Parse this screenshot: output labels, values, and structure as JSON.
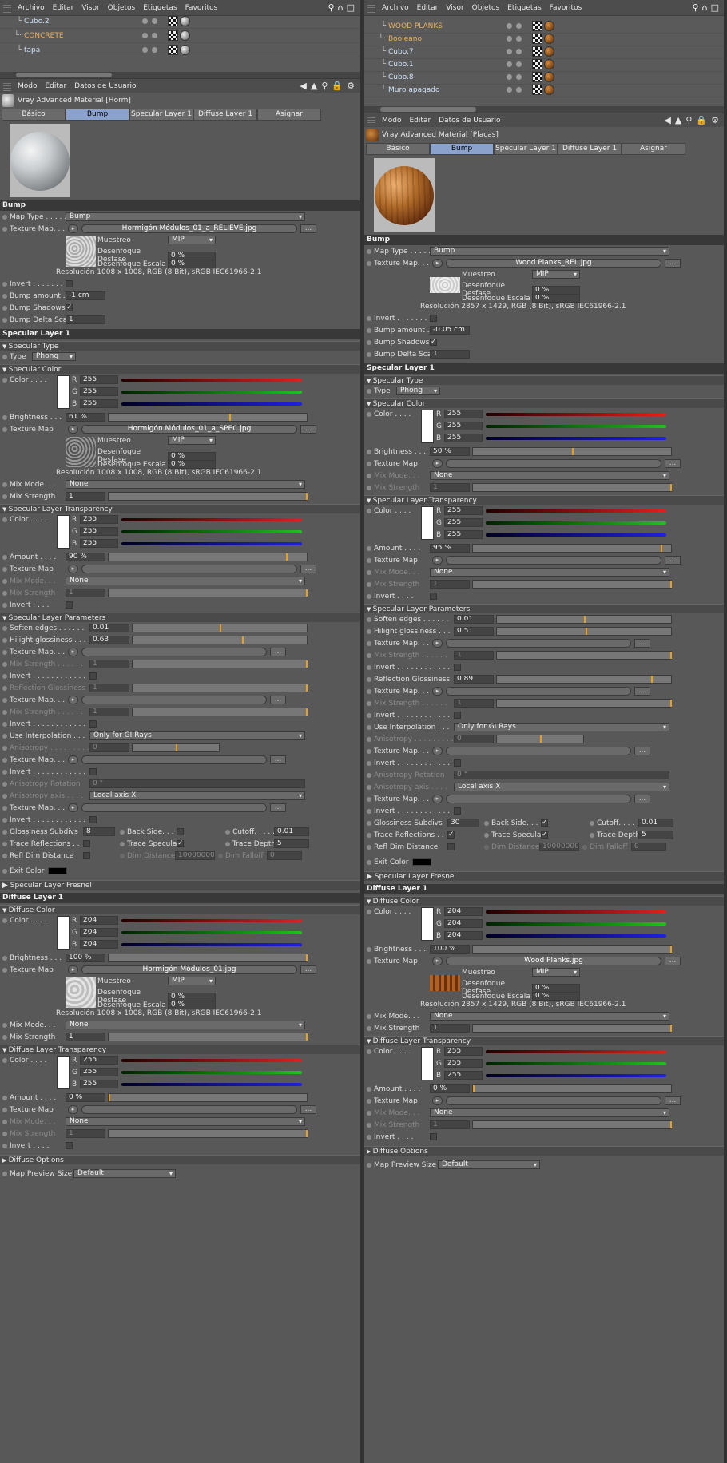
{
  "menu": {
    "items": [
      "Archivo",
      "Editar",
      "Visor",
      "Objetos",
      "Etiquetas",
      "Favoritos"
    ]
  },
  "attr_menu": {
    "items": [
      "Modo",
      "Editar",
      "Datos de Usuario"
    ]
  },
  "left": {
    "objects": [
      "Cubo.2",
      "CONCRETE",
      "tapa"
    ],
    "material_title": "Vray Advanced Material [Horm]",
    "tabs": [
      "Básico",
      "Bump",
      "Specular Layer 1",
      "Diffuse Layer 1",
      "Asignar"
    ],
    "bump": {
      "section": "Bump",
      "map_type_label": "Map Type . . . . . . .",
      "map_type": "Bump",
      "texture_label": "Texture Map. . . . . . .",
      "texture": "Hormigón Módulos_01_a_RELIEVE.jpg",
      "sampling_label": "Muestreo",
      "sampling": "MIP",
      "blur_offset_label": "Desenfoque Desfase",
      "blur_offset": "0 %",
      "blur_scale_label": "Desenfoque Escala",
      "blur_scale": "0 %",
      "resolution": "Resolución 1008 x 1008, RGB (8 Bit), sRGB IEC61966-2.1",
      "invert_label": "Invert . . . . . . . . . . .",
      "amount_label": "Bump amount . . . .",
      "amount": "-1 cm",
      "shadows_label": "Bump Shadows",
      "delta_label": "Bump Delta Scale",
      "delta": "1"
    },
    "spec_type": {
      "value": "Phong"
    },
    "spec_color": {
      "r": "255",
      "g": "255",
      "b": "255",
      "brightness": "61 %",
      "brightness_frac": 0.61,
      "texture": "Hormigón Módulos_01_a_SPEC.jpg",
      "sampling": "MIP",
      "blur_offset": "0 %",
      "blur_scale": "0 %",
      "resolution": "Resolución 1008 x 1008, RGB (8 Bit), sRGB IEC61966-2.1",
      "mix_mode": "None",
      "mix_strength": "1"
    },
    "spec_transp": {
      "r": "255",
      "g": "255",
      "b": "255",
      "amount": "90 %",
      "amount_frac": 0.9,
      "mix_mode": "None",
      "mix_strength": "1"
    },
    "spec_params": {
      "soften": "0.01",
      "soften_frac": 0.5,
      "hilight": "0.63",
      "hilight_frac": 0.63,
      "mix_strength": "1",
      "refl_gloss": "1",
      "refl_gloss_frac": 1.0,
      "mix_strength2": "1",
      "use_interp": "Only for GI Rays",
      "aniso": "0",
      "aniso_frac": 0.5,
      "aniso_rot": "0 °",
      "aniso_axis": "Local axis X",
      "gloss_subdivs": "8",
      "cutoff": "0.01",
      "trace_depth": "5",
      "dim_distance": "10000000",
      "dim_falloff": "0"
    },
    "diffuse_color": {
      "r": "204",
      "g": "204",
      "b": "204",
      "brightness": "100 %",
      "brightness_frac": 1.0,
      "texture": "Hormigón Módulos_01.jpg",
      "sampling": "MIP",
      "blur_offset": "0 %",
      "blur_scale": "0 %",
      "resolution": "Resolución 1008 x 1008, RGB (8 Bit), sRGB IEC61966-2.1",
      "mix_mode": "None",
      "mix_strength": "1"
    },
    "diffuse_transp": {
      "r": "255",
      "g": "255",
      "b": "255",
      "amount": "0 %",
      "amount_frac": 0.0,
      "mix_mode": "None",
      "mix_strength": "1"
    },
    "preview_size": "Default"
  },
  "right": {
    "objects": [
      "WOOD PLANKS",
      "Booleano",
      "Cubo.7",
      "Cubo.1",
      "Cubo.8",
      "Muro apagado"
    ],
    "material_title": "Vray Advanced Material [Placas]",
    "tabs": [
      "Básico",
      "Bump",
      "Specular Layer 1",
      "Diffuse Layer 1",
      "Asignar"
    ],
    "bump": {
      "section": "Bump",
      "map_type_label": "Map Type . . . . . . .",
      "map_type": "Bump",
      "texture_label": "Texture Map. . . . . . .",
      "texture": "Wood Planks_REL.jpg",
      "sampling_label": "Muestreo",
      "sampling": "MIP",
      "blur_offset_label": "Desenfoque Desfase",
      "blur_offset": "0 %",
      "blur_scale_label": "Desenfoque Escala",
      "blur_scale": "0 %",
      "resolution": "Resolución 2857 x 1429, RGB (8 Bit), sRGB IEC61966-2.1",
      "invert_label": "Invert . . . . . . . . . . .",
      "amount_label": "Bump amount . . . .",
      "amount": "-0.05 cm",
      "shadows_label": "Bump Shadows",
      "delta_label": "Bump Delta Scale",
      "delta": "1"
    },
    "spec_type": {
      "value": "Phong"
    },
    "spec_color": {
      "r": "255",
      "g": "255",
      "b": "255",
      "brightness": "50 %",
      "brightness_frac": 0.5,
      "texture": "",
      "sampling": "",
      "blur_offset": "",
      "blur_scale": "",
      "resolution": "",
      "mix_mode": "None",
      "mix_strength": "1"
    },
    "spec_transp": {
      "r": "255",
      "g": "255",
      "b": "255",
      "amount": "95 %",
      "amount_frac": 0.95,
      "mix_mode": "None",
      "mix_strength": "1"
    },
    "spec_params": {
      "soften": "0.01",
      "soften_frac": 0.5,
      "hilight": "0.51",
      "hilight_frac": 0.51,
      "mix_strength": "1",
      "refl_gloss": "0.89",
      "refl_gloss_frac": 0.89,
      "mix_strength2": "1",
      "use_interp": "Only for GI Rays",
      "aniso": "0",
      "aniso_frac": 0.5,
      "aniso_rot": "0 °",
      "aniso_axis": "Local axis X",
      "gloss_subdivs": "30",
      "cutoff": "0.01",
      "trace_depth": "5",
      "dim_distance": "10000000",
      "dim_falloff": "0"
    },
    "diffuse_color": {
      "r": "204",
      "g": "204",
      "b": "204",
      "brightness": "100 %",
      "brightness_frac": 1.0,
      "texture": "Wood Planks.jpg",
      "sampling": "MIP",
      "blur_offset": "0 %",
      "blur_scale": "0 %",
      "resolution": "Resolución 2857 x 1429, RGB (8 Bit), sRGB IEC61966-2.1",
      "mix_mode": "None",
      "mix_strength": "1"
    },
    "diffuse_transp": {
      "r": "255",
      "g": "255",
      "b": "255",
      "amount": "0 %",
      "amount_frac": 0.0,
      "mix_mode": "None",
      "mix_strength": "1"
    },
    "preview_size": "Default"
  },
  "labels": {
    "specular_layer": "Specular Layer 1",
    "specular_type": "Specular Type",
    "type": "Type",
    "specular_color": "Specular Color",
    "color": "Color . . . .",
    "brightness": "Brightness . . .",
    "texture_map": "Texture Map",
    "mix_mode": "Mix Mode. . .",
    "mix_strength": "Mix Strength",
    "spec_transp": "Specular Layer Transparency",
    "amount": "Amount . . . .",
    "invert": "Invert . . . .",
    "spec_params": "Specular Layer Parameters",
    "soften": "Soften edges . . . . . .",
    "hilight": "Hilight glossiness . . .",
    "texture_map_dots": "Texture Map. . . . . . .",
    "mix_strength_dots": "Mix Strength . . . . . .",
    "invert_dots": "Invert . . . . . . . . . . . .",
    "refl_gloss": "Reflection Glossiness",
    "use_interp": "Use Interpolation . . .",
    "aniso": "Anisotropy . . . . . . . . .",
    "aniso_rot": "Anisotropy Rotation",
    "aniso_axis": "Anisotropy axis . . . .",
    "gloss_subdivs": "Glossiness Subdivs",
    "back_side": "Back Side. . . . .",
    "cutoff": "Cutoff. . . . .",
    "trace_refl": "Trace Reflections . .",
    "trace_spec": "Trace Specular",
    "trace_depth": "Trace Depth",
    "refl_dim": "Refl Dim Distance",
    "dim_distance": "Dim Distance",
    "dim_falloff": "Dim Falloff",
    "exit_color": "Exit Color",
    "spec_fresnel": "Specular Layer Fresnel",
    "diffuse_layer": "Diffuse Layer 1",
    "diffuse_color": "Diffuse Color",
    "diffuse_transp": "Diffuse Layer Transparency",
    "diffuse_options": "Diffuse Options",
    "preview_size": "Map Preview Size",
    "r": "R",
    "g": "G",
    "b": "B"
  }
}
